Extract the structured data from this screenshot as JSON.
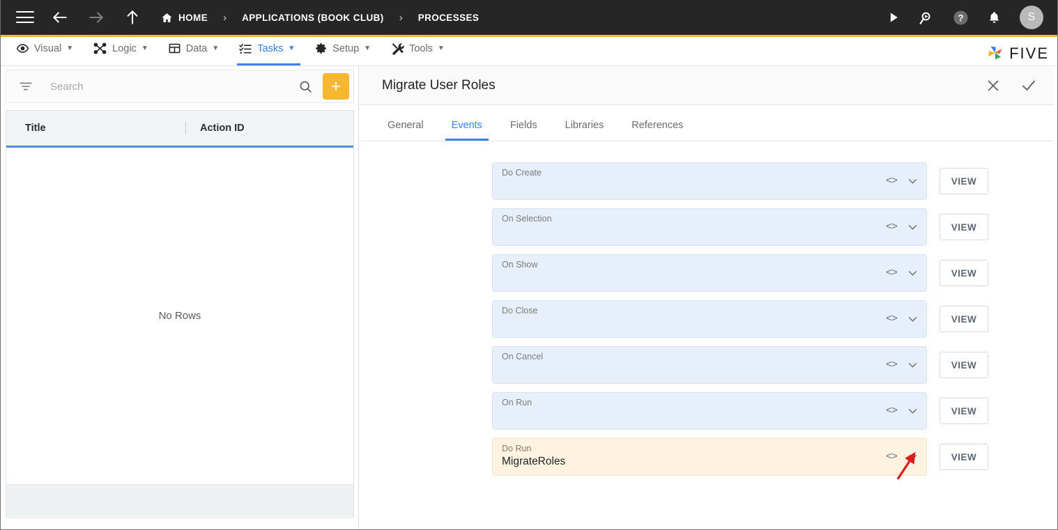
{
  "topbar": {
    "menu_icon": "hamburger-icon",
    "back_icon": "arrow-left-icon",
    "forward_icon": "arrow-right-icon",
    "up_icon": "arrow-up-icon",
    "breadcrumbs": [
      {
        "label": "HOME",
        "icon": "home-icon"
      },
      {
        "label": "APPLICATIONS (BOOK CLUB)",
        "icon": ""
      },
      {
        "label": "PROCESSES",
        "icon": ""
      }
    ],
    "separator": "›",
    "actions": [
      {
        "name": "run-icon",
        "label": ""
      },
      {
        "name": "search-chat-icon",
        "label": ""
      },
      {
        "name": "help-icon",
        "label": ""
      },
      {
        "name": "notifications-bell-icon",
        "label": ""
      }
    ],
    "avatar_initial": "S",
    "bar_color": "#262626",
    "accent_color": "#f3b828"
  },
  "menubar": {
    "items": [
      {
        "label": "Visual",
        "icon": "eye-icon",
        "caret": "▼",
        "active": false
      },
      {
        "label": "Logic",
        "icon": "nodes-icon",
        "caret": "▼",
        "active": false
      },
      {
        "label": "Data",
        "icon": "table-icon",
        "caret": "▼",
        "active": false
      },
      {
        "label": "Tasks",
        "icon": "checklist-icon",
        "caret": "▼",
        "active": true
      },
      {
        "label": "Setup",
        "icon": "gear-icon",
        "caret": "▼",
        "active": false
      },
      {
        "label": "Tools",
        "icon": "tools-icon",
        "caret": "▼",
        "active": false
      }
    ],
    "brand": "FIVE",
    "active_color": "#3b82e8"
  },
  "sidebar": {
    "filter_icon": "filter-icon",
    "search_placeholder": "Search",
    "search_value": "",
    "search_icon": "search-icon",
    "add_button_label": "+",
    "add_button_color": "#f7b731",
    "grid": {
      "columns": [
        "Title",
        "Action ID"
      ],
      "rows": [],
      "empty_message": "No Rows",
      "header_underline_color": "#4a90d9"
    }
  },
  "panel": {
    "title": "Migrate User Roles",
    "close_icon": "close-icon",
    "confirm_icon": "check-icon",
    "tabs": [
      {
        "label": "General",
        "active": false
      },
      {
        "label": "Events",
        "active": true
      },
      {
        "label": "Fields",
        "active": false
      },
      {
        "label": "Libraries",
        "active": false
      },
      {
        "label": "References",
        "active": false
      }
    ],
    "view_button_label": "VIEW",
    "code_icon": "code-icon",
    "chevron_icon": "chevron-down-icon",
    "events": [
      {
        "label": "Do Create",
        "value": "",
        "highlight": false
      },
      {
        "label": "On Selection",
        "value": "",
        "highlight": false
      },
      {
        "label": "On Show",
        "value": "",
        "highlight": false
      },
      {
        "label": "Do Close",
        "value": "",
        "highlight": false
      },
      {
        "label": "On Cancel",
        "value": "",
        "highlight": false
      },
      {
        "label": "On Run",
        "value": "",
        "highlight": false
      },
      {
        "label": "Do Run",
        "value": "MigrateRoles",
        "highlight": true
      }
    ]
  },
  "annotation": {
    "arrow_color": "#e01b1b",
    "points_at": "chevron-down-icon of Do Run event"
  }
}
